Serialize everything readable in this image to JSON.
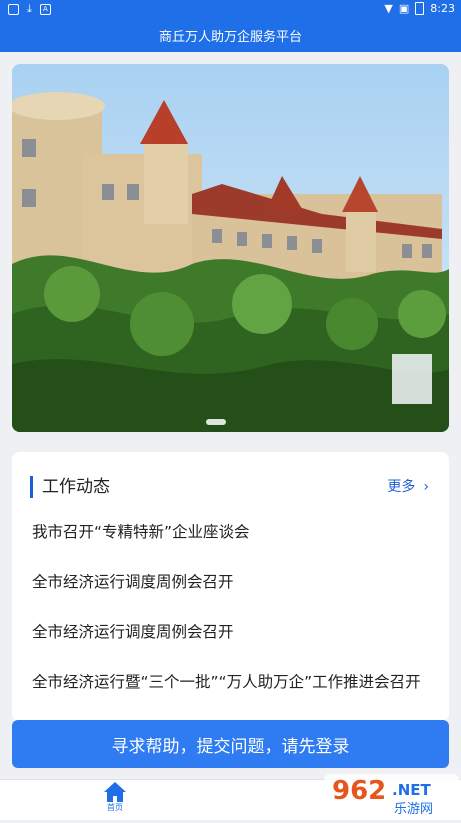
{
  "status_bar": {
    "time": "8:23"
  },
  "header": {
    "title": "商丘万人助万企服务平台"
  },
  "news": {
    "section_title": "工作动态",
    "more_label": "更多",
    "items": [
      "我市召开“专精特新”企业座谈会",
      "全市经济运行调度周例会召开",
      "全市经济运行调度周例会召开",
      "全市经济运行暨“三个一批”“万人助万企”工作推进会召开"
    ]
  },
  "login_button": {
    "label": "寻求帮助，提交问题，请先登录"
  },
  "tab_bar": {
    "home_label": "首页"
  },
  "watermark": {
    "text1": "962",
    "text2": ".NET",
    "text3": "乐游网"
  },
  "colors": {
    "primary": "#1f6fe8",
    "button": "#2e7bf2"
  }
}
